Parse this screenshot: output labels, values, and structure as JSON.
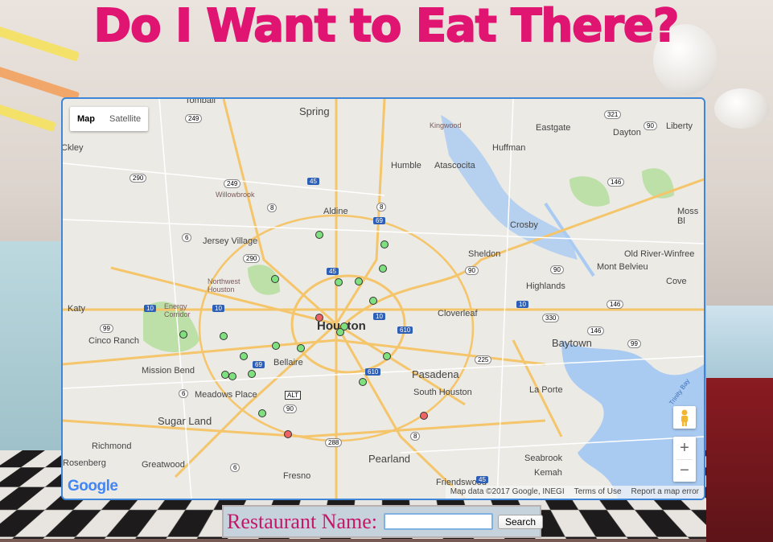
{
  "page": {
    "title": "Do I Want to Eat There?"
  },
  "map": {
    "type_controls": [
      "Map",
      "Satellite"
    ],
    "active_type": "Map",
    "attribution": "Map data ©2017 Google, INEGI",
    "terms_link": "Terms of Use",
    "report_link": "Report a map error",
    "logo_text": "Google",
    "zoom_in": "+",
    "zoom_out": "−",
    "marker_colors": {
      "good": "#7ee07e",
      "bad": "#ee6464"
    },
    "places": [
      "Tomball",
      "Spring",
      "Kingwood",
      "Eastgate",
      "Dayton",
      "Liberty",
      "Huffman",
      "Humble",
      "Atascocita",
      "Ckley",
      "Willowbrook",
      "Aldine",
      "Crosby",
      "Moss Bl",
      "Jersey Village",
      "Sheldon",
      "Old River-Winfree",
      "Northwest Houston",
      "Mont Belvieu",
      "Highlands",
      "Cove",
      "Katy",
      "Energy Corridor",
      "Cloverleaf",
      "Houston",
      "Baytown",
      "Cinco Ranch",
      "Bellaire",
      "Mission Bend",
      "Pasadena",
      "Meadows Place",
      "South Houston",
      "La Porte",
      "Sugar Land",
      "Richmond",
      "Pearland",
      "Seabrook",
      "Kemah",
      "Rosenberg",
      "Greatwood",
      "Fresno",
      "Friendswood",
      "Trinity Bay"
    ],
    "highway_shields": [
      "249",
      "321",
      "90",
      "290",
      "249",
      "45",
      "8",
      "69",
      "6",
      "8",
      "146",
      "290",
      "45",
      "90",
      "10",
      "10",
      "10",
      "610",
      "146",
      "330",
      "146",
      "99",
      "10",
      "99",
      "225",
      "69",
      "610",
      "6",
      "90",
      "8",
      "288",
      "6",
      "45",
      "90",
      "ALT"
    ]
  },
  "search": {
    "label": "Restaurant Name:",
    "input_value": "",
    "button_label": "Search"
  }
}
